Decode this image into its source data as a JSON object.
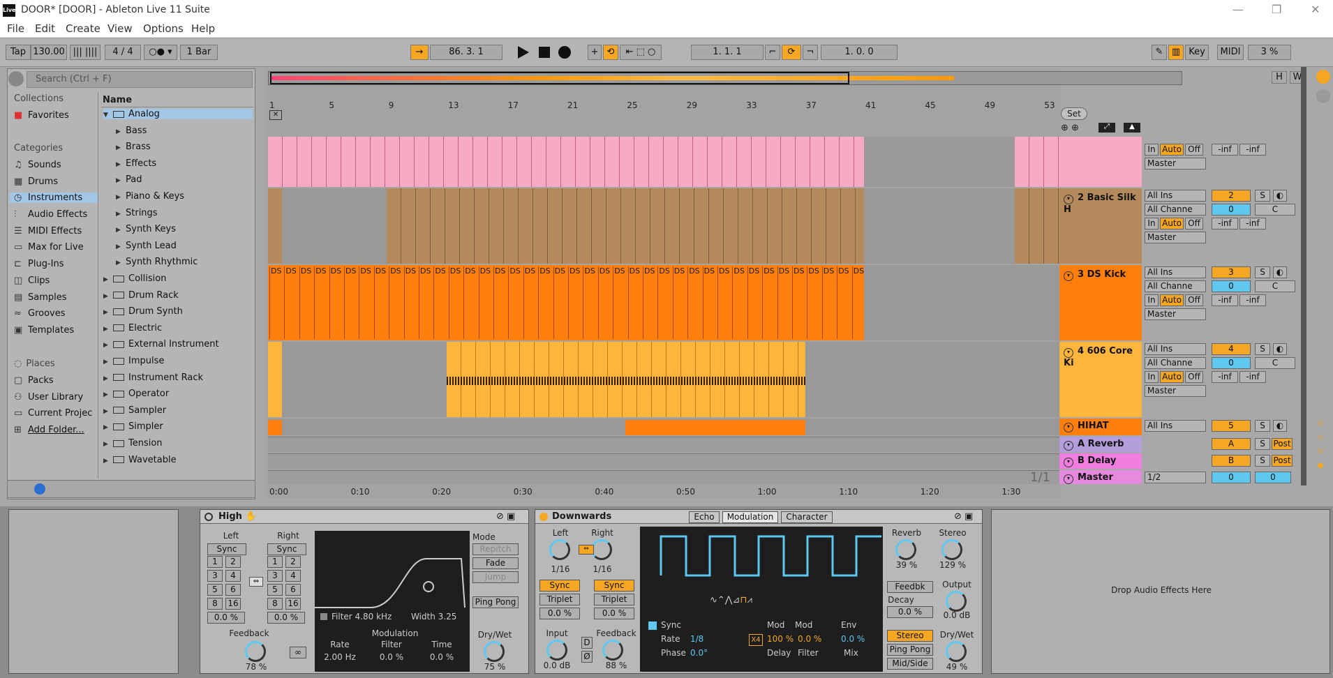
{
  "window": {
    "title": "DOOR*  [DOOR] - Ableton Live 11 Suite",
    "logo": "Live"
  },
  "menu": [
    "File",
    "Edit",
    "Create",
    "View",
    "Options",
    "Help"
  ],
  "toolbar": {
    "tap": "Tap",
    "tempo": "130.00",
    "signature": "4 / 4",
    "quantize": "1 Bar",
    "position": "86.  3.  1",
    "loop_start": "1.  1.  1",
    "loop_len": "1.  0.  0",
    "key": "Key",
    "midi": "MIDI",
    "cpu": "3 %"
  },
  "browser": {
    "search_placeholder": "Search (Ctrl + F)",
    "collections_label": "Collections",
    "favorites": "Favorites",
    "categories_label": "Categories",
    "categories": [
      "Sounds",
      "Drums",
      "Instruments",
      "Audio Effects",
      "MIDI Effects",
      "Max for Live",
      "Plug-Ins",
      "Clips",
      "Samples",
      "Grooves",
      "Templates"
    ],
    "places_label": "Places",
    "places": [
      "Packs",
      "User Library",
      "Current Projec",
      "Add Folder..."
    ],
    "name_header": "Name",
    "items": [
      {
        "label": "Analog",
        "type": "folder-open"
      },
      {
        "label": "Bass",
        "type": "sub"
      },
      {
        "label": "Brass",
        "type": "sub"
      },
      {
        "label": "Effects",
        "type": "sub"
      },
      {
        "label": "Pad",
        "type": "sub"
      },
      {
        "label": "Piano & Keys",
        "type": "sub"
      },
      {
        "label": "Strings",
        "type": "sub"
      },
      {
        "label": "Synth Keys",
        "type": "sub"
      },
      {
        "label": "Synth Lead",
        "type": "sub"
      },
      {
        "label": "Synth Rhythmic",
        "type": "sub"
      },
      {
        "label": "Collision",
        "type": "folder"
      },
      {
        "label": "Drum Rack",
        "type": "folder"
      },
      {
        "label": "Drum Synth",
        "type": "folder"
      },
      {
        "label": "Electric",
        "type": "folder"
      },
      {
        "label": "External Instrument",
        "type": "folder"
      },
      {
        "label": "Impulse",
        "type": "folder"
      },
      {
        "label": "Instrument Rack",
        "type": "folder"
      },
      {
        "label": "Operator",
        "type": "folder"
      },
      {
        "label": "Sampler",
        "type": "folder"
      },
      {
        "label": "Simpler",
        "type": "folder"
      },
      {
        "label": "Tension",
        "type": "folder"
      },
      {
        "label": "Wavetable",
        "type": "folder"
      }
    ]
  },
  "ruler": {
    "bars": [
      "1",
      "5",
      "9",
      "13",
      "17",
      "21",
      "25",
      "29",
      "33",
      "37",
      "41",
      "45",
      "49",
      "53"
    ],
    "times": [
      "0:00",
      "0:10",
      "0:20",
      "0:30",
      "0:40",
      "0:50",
      "1:00",
      "1:10",
      "1:20",
      "1:30"
    ],
    "set": "Set",
    "page": "1/1"
  },
  "clip_label": "DS",
  "tracks": [
    {
      "name": "",
      "color": "#f7a8c4",
      "num": "",
      "input": "",
      "channel": "",
      "output": "Master"
    },
    {
      "name": "2 Basic Silk H",
      "color": "#b48a5c",
      "num": "2",
      "input": "All Ins",
      "channel": "All Channe",
      "output": "Master"
    },
    {
      "name": "3 DS Kick",
      "color": "#ff7f0e",
      "num": "3",
      "input": "All Ins",
      "channel": "All Channe",
      "output": "Master"
    },
    {
      "name": "4 606 Core Ki",
      "color": "#ffb43c",
      "num": "4",
      "input": "All Ins",
      "channel": "All Channe",
      "output": "Master"
    },
    {
      "name": "HIHAT",
      "color": "#ff7f0e",
      "num": "5",
      "input": "All Ins",
      "channel": "",
      "output": ""
    },
    {
      "name": "A Reverb",
      "color": "#b39ddb",
      "num": "A",
      "input": "",
      "channel": "",
      "output": ""
    },
    {
      "name": "B Delay",
      "color": "#ef7ee0",
      "num": "B",
      "input": "",
      "channel": "",
      "output": ""
    },
    {
      "name": "Master",
      "color": "#e68ae0",
      "num": "0",
      "input": "1/2",
      "channel": "",
      "output": ""
    }
  ],
  "mixer": {
    "in": "In",
    "auto": "Auto",
    "off": "Off",
    "inf": "-inf",
    "s": "S",
    "c": "C",
    "zero": "0",
    "post": "Post"
  },
  "devices": {
    "high": {
      "title": "High",
      "left": "Left",
      "right": "Right",
      "sync": "Sync",
      "nums": [
        "1",
        "2",
        "3",
        "4",
        "5",
        "6",
        "8",
        "16"
      ],
      "pct": "0.0 %",
      "mode": "Mode",
      "repitch": "Repitch",
      "fade": "Fade",
      "jump": "Jump",
      "pingpong": "Ping Pong",
      "filter": "Filter  4.80 kHz",
      "width": "Width  3.25",
      "modulation": "Modulation",
      "rate": "Rate",
      "filter_lbl": "Filter",
      "time": "Time",
      "rate_v": "2.00 Hz",
      "filter_v": "0.0 %",
      "time_v": "0.0 %",
      "feedback": "Feedback",
      "feedback_v": "78 %",
      "drywet": "Dry/Wet",
      "drywet_v": "75 %"
    },
    "down": {
      "title": "Downwards",
      "tabs": [
        "Echo",
        "Modulation",
        "Character"
      ],
      "left": "Left",
      "right": "Right",
      "lv": "1/16",
      "rv": "1/16",
      "sync": "Sync",
      "triplet": "Triplet",
      "pct": "0.0 %",
      "input": "Input",
      "input_v": "0.0 dB",
      "feedback": "Feedback",
      "feedback_v": "88 %",
      "scope_sync": "Sync",
      "rate": "Rate",
      "rate_v": "1/8",
      "phase": "Phase",
      "phase_v": "0.0°",
      "mod": "Mod",
      "x4": "X4",
      "mod1": "100 %",
      "mod2": "0.0 %",
      "env": "Env",
      "env_v": "0.0 %",
      "delay": "Delay",
      "filter": "Filter",
      "mix": "Mix",
      "reverb": "Reverb",
      "reverb_v": "39 %",
      "stereo": "Stereo",
      "stereo_v": "129 %",
      "feedbk": "Feedbk",
      "decay": "Decay",
      "decay_v": "0.0 %",
      "output": "Output",
      "output_v": "0.0 dB",
      "stereo_btn": "Stereo",
      "pingpong": "Ping Pong",
      "midside": "Mid/Side",
      "drywet": "Dry/Wet",
      "drywet_v": "49 %"
    },
    "drop": "Drop Audio Effects Here"
  }
}
